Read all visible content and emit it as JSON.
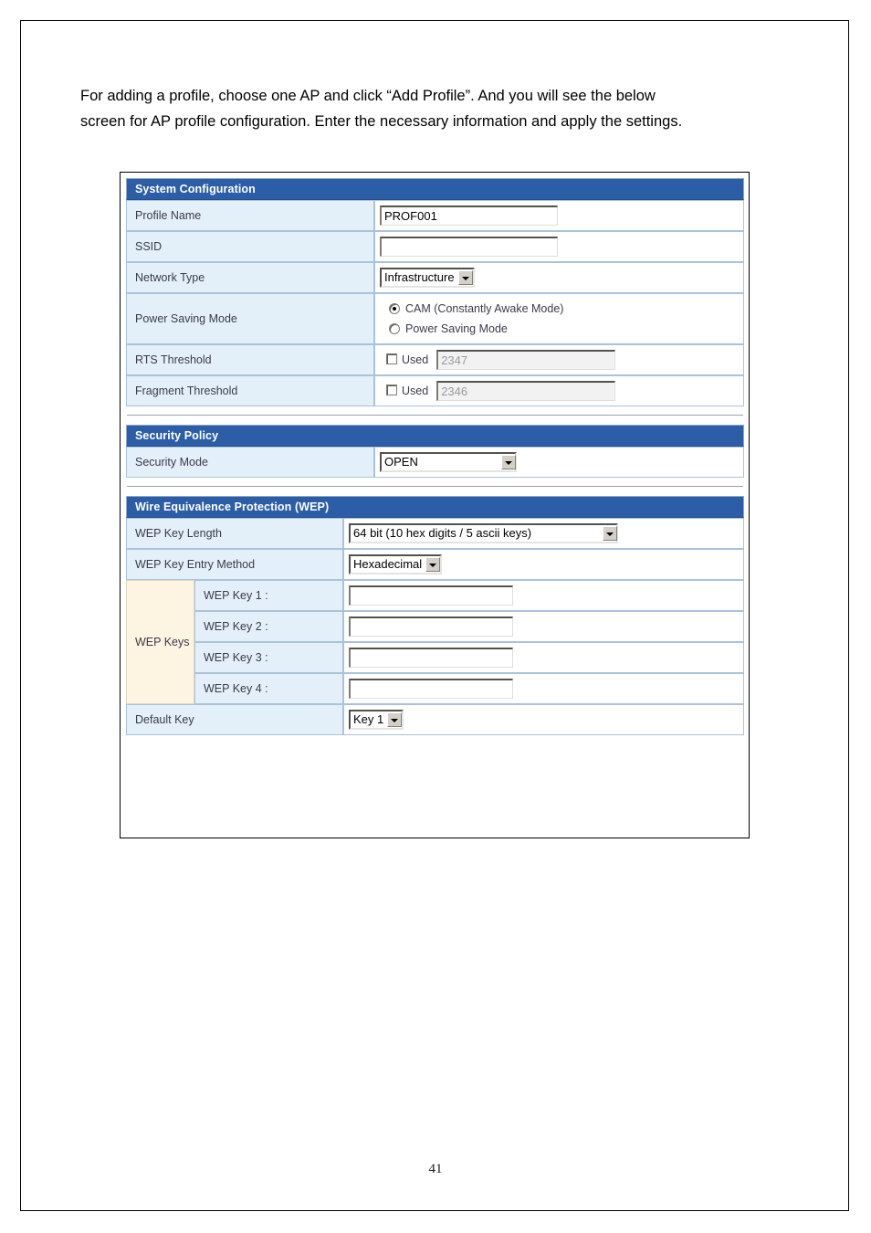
{
  "document": {
    "page_number": "41",
    "intro_line1": "For adding a profile, choose one AP and click “Add Profile”. And you will see the below",
    "intro_line2": "screen for AP profile configuration. Enter the necessary information and apply the settings."
  },
  "colors": {
    "section_header_bg": "#2c5ea8",
    "section_header_text": "#ffffff",
    "label_cell_bg": "#e4f0f9",
    "cream_cell_bg": "#fdf4e2",
    "cell_border": "#a9c3da",
    "disabled_text": "#9a9a9a"
  },
  "system_configuration": {
    "title": "System Configuration",
    "profile_name": {
      "label": "Profile Name",
      "value": "PROF001"
    },
    "ssid": {
      "label": "SSID",
      "value": ""
    },
    "network_type": {
      "label": "Network Type",
      "selected": "Infrastructure"
    },
    "power_saving_mode": {
      "label": "Power Saving Mode",
      "options": [
        {
          "label": "CAM (Constantly Awake Mode)",
          "selected": true
        },
        {
          "label": "Power Saving Mode",
          "selected": false
        }
      ]
    },
    "rts_threshold": {
      "label": "RTS Threshold",
      "used_label": "Used",
      "used_checked": false,
      "value": "2347",
      "disabled": true
    },
    "fragment_threshold": {
      "label": "Fragment Threshold",
      "used_label": "Used",
      "used_checked": false,
      "value": "2346",
      "disabled": true
    }
  },
  "security_policy": {
    "title": "Security Policy",
    "security_mode": {
      "label": "Security Mode",
      "selected": "OPEN"
    }
  },
  "wep": {
    "title": "Wire Equivalence Protection (WEP)",
    "key_length": {
      "label": "WEP Key Length",
      "selected": "64 bit (10 hex digits / 5 ascii keys)"
    },
    "key_entry_method": {
      "label": "WEP Key Entry Method",
      "selected": "Hexadecimal"
    },
    "keys_group_label": "WEP Keys",
    "keys": [
      {
        "label": "WEP Key 1 :",
        "value": ""
      },
      {
        "label": "WEP Key 2 :",
        "value": ""
      },
      {
        "label": "WEP Key 3 :",
        "value": ""
      },
      {
        "label": "WEP Key 4 :",
        "value": ""
      }
    ],
    "default_key": {
      "label": "Default Key",
      "selected": "Key 1"
    }
  }
}
